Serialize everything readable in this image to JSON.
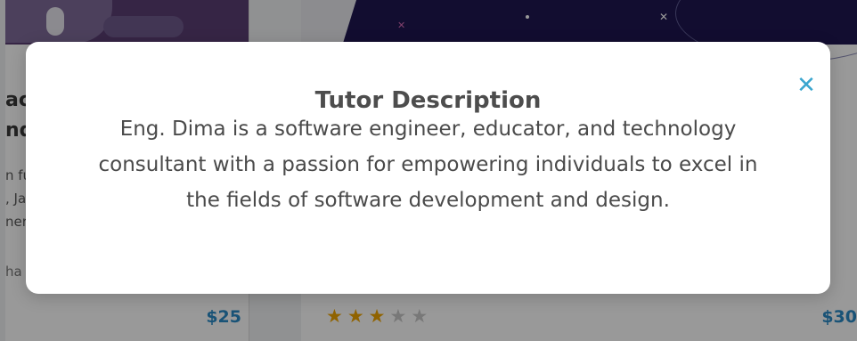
{
  "background": {
    "left_card": {
      "title_fragment_lines": [
        "ac",
        "nd"
      ],
      "description_fragment_lines": [
        "n fu",
        ", Ja",
        "ners"
      ],
      "author_fragment": "ha",
      "price": "$25"
    },
    "right_card": {
      "rating": {
        "filled": 3,
        "total": 5
      },
      "price": "$30"
    }
  },
  "modal": {
    "title": "Tutor Description",
    "body": "Eng. Dima is a software engineer, educator, and technology consultant with a passion for empowering individuals to excel in the fields of software development and design.",
    "close_icon": "close-icon",
    "accent_color": "#3aa6cf"
  }
}
